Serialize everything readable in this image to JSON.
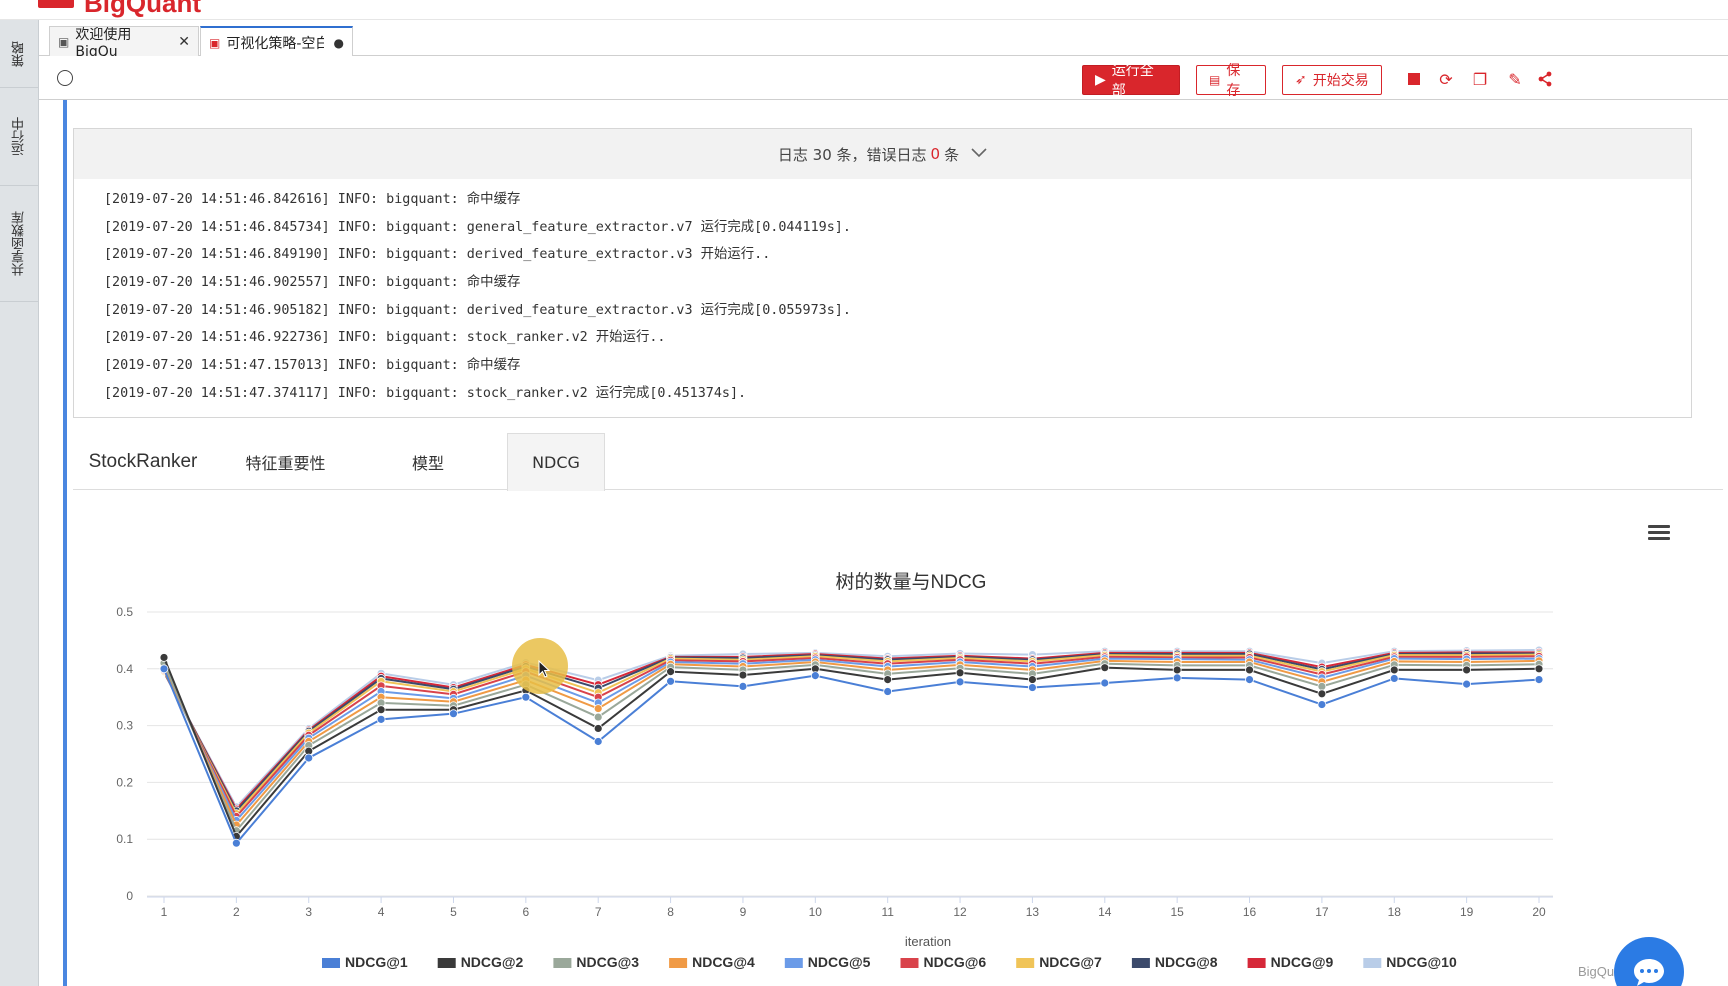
{
  "brand": {
    "name": "BigQuant"
  },
  "sidebar": {
    "items": [
      {
        "label": "策略"
      },
      {
        "label": "运行中"
      },
      {
        "label": "共享函数库"
      }
    ]
  },
  "tabs": [
    {
      "label": "欢迎使用BigQu",
      "close": "✕"
    },
    {
      "label": "可视化策略-空白",
      "modified": "●"
    }
  ],
  "toolbar": {
    "run_all": "运行全部",
    "save": "保存",
    "start_trading": "开始交易"
  },
  "log": {
    "summary_prefix": "日志 30 条，错误日志",
    "error_count": "0",
    "summary_suffix": "条",
    "lines": [
      "[2019-07-20 14:51:46.842616] INFO: bigquant: 命中缓存",
      "[2019-07-20 14:51:46.845734] INFO: bigquant: general_feature_extractor.v7 运行完成[0.044119s].",
      "[2019-07-20 14:51:46.849190] INFO: bigquant: derived_feature_extractor.v3 开始运行..",
      "[2019-07-20 14:51:46.902557] INFO: bigquant: 命中缓存",
      "[2019-07-20 14:51:46.905182] INFO: bigquant: derived_feature_extractor.v3 运行完成[0.055973s].",
      "[2019-07-20 14:51:46.922736] INFO: bigquant: stock_ranker.v2 开始运行..",
      "[2019-07-20 14:51:47.157013] INFO: bigquant: 命中缓存",
      "[2019-07-20 14:51:47.374117] INFO: bigquant: stock_ranker.v2 运行完成[0.451374s]."
    ]
  },
  "result_tabs": [
    {
      "label": "StockRanker"
    },
    {
      "label": "特征重要性"
    },
    {
      "label": "模型"
    },
    {
      "label": "NDCG",
      "active": true
    }
  ],
  "watermark": "BigQu",
  "chart_data": {
    "type": "line",
    "title": "树的数量与NDCG",
    "xlabel": "iteration",
    "ylabel": "",
    "x": [
      1,
      2,
      3,
      4,
      5,
      6,
      7,
      8,
      9,
      10,
      11,
      12,
      13,
      14,
      15,
      16,
      17,
      18,
      19,
      20
    ],
    "ylim": [
      0,
      0.5
    ],
    "yticks": [
      0,
      0.1,
      0.2,
      0.3,
      0.4,
      0.5
    ],
    "grid": true,
    "legend": "bottom",
    "series": [
      {
        "name": "NDCG@1",
        "color": "#4a7fd6",
        "values": [
          0.4,
          0.093,
          0.243,
          0.311,
          0.321,
          0.35,
          0.272,
          0.378,
          0.369,
          0.388,
          0.36,
          0.377,
          0.367,
          0.375,
          0.384,
          0.381,
          0.337,
          0.383,
          0.373,
          0.381
        ]
      },
      {
        "name": "NDCG@2",
        "color": "#3a3a3a",
        "values": [
          0.42,
          0.105,
          0.255,
          0.328,
          0.328,
          0.362,
          0.295,
          0.395,
          0.389,
          0.4,
          0.381,
          0.393,
          0.381,
          0.402,
          0.398,
          0.398,
          0.356,
          0.398,
          0.398,
          0.4
        ]
      },
      {
        "name": "NDCG@3",
        "color": "#9aa89a",
        "values": [
          0.41,
          0.115,
          0.265,
          0.34,
          0.335,
          0.372,
          0.315,
          0.403,
          0.398,
          0.407,
          0.391,
          0.401,
          0.391,
          0.409,
          0.406,
          0.406,
          0.369,
          0.407,
          0.406,
          0.408
        ]
      },
      {
        "name": "NDCG@4",
        "color": "#f09a45",
        "values": [
          0.405,
          0.125,
          0.272,
          0.35,
          0.342,
          0.38,
          0.33,
          0.408,
          0.404,
          0.412,
          0.398,
          0.407,
          0.398,
          0.414,
          0.412,
          0.412,
          0.377,
          0.413,
          0.412,
          0.414
        ]
      },
      {
        "name": "NDCG@5",
        "color": "#6b9be8",
        "values": [
          0.4,
          0.133,
          0.278,
          0.36,
          0.348,
          0.388,
          0.34,
          0.412,
          0.409,
          0.416,
          0.404,
          0.412,
          0.404,
          0.418,
          0.417,
          0.416,
          0.384,
          0.418,
          0.417,
          0.418
        ]
      },
      {
        "name": "NDCG@6",
        "color": "#d9434b",
        "values": [
          0.398,
          0.14,
          0.283,
          0.37,
          0.355,
          0.395,
          0.35,
          0.415,
          0.413,
          0.419,
          0.409,
          0.416,
          0.409,
          0.421,
          0.42,
          0.42,
          0.39,
          0.421,
          0.421,
          0.422
        ]
      },
      {
        "name": "NDCG@7",
        "color": "#f0c458",
        "values": [
          0.396,
          0.145,
          0.287,
          0.378,
          0.36,
          0.4,
          0.358,
          0.418,
          0.416,
          0.422,
          0.413,
          0.419,
          0.413,
          0.424,
          0.423,
          0.423,
          0.395,
          0.424,
          0.424,
          0.425
        ]
      },
      {
        "name": "NDCG@8",
        "color": "#3b4a6b",
        "values": [
          0.395,
          0.15,
          0.29,
          0.383,
          0.364,
          0.404,
          0.366,
          0.42,
          0.419,
          0.424,
          0.416,
          0.421,
          0.416,
          0.426,
          0.426,
          0.426,
          0.399,
          0.426,
          0.427,
          0.427
        ]
      },
      {
        "name": "NDCG@9",
        "color": "#d62839",
        "values": [
          0.394,
          0.153,
          0.292,
          0.387,
          0.367,
          0.407,
          0.372,
          0.421,
          0.421,
          0.426,
          0.418,
          0.423,
          0.418,
          0.428,
          0.428,
          0.428,
          0.403,
          0.428,
          0.429,
          0.429
        ]
      },
      {
        "name": "NDCG@10",
        "color": "#b9cde8",
        "values": [
          0.393,
          0.157,
          0.295,
          0.392,
          0.372,
          0.411,
          0.38,
          0.423,
          0.426,
          0.428,
          0.422,
          0.427,
          0.425,
          0.431,
          0.431,
          0.431,
          0.41,
          0.431,
          0.432,
          0.433
        ]
      }
    ]
  }
}
